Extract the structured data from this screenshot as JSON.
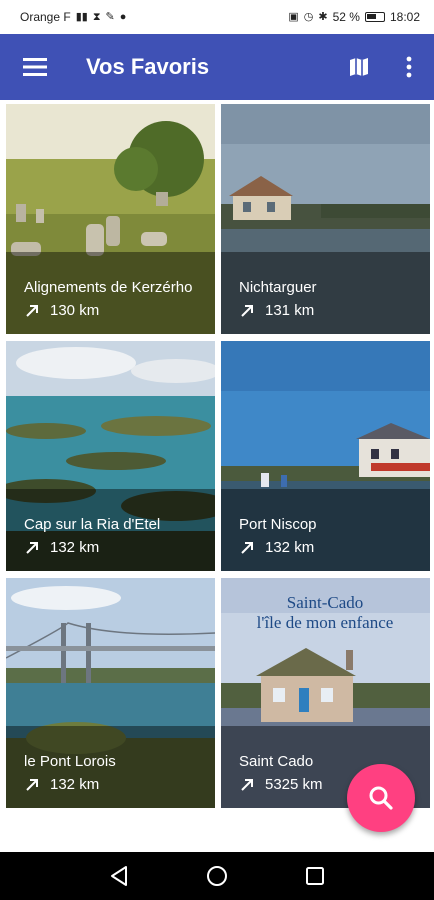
{
  "status_bar": {
    "carrier": "Orange F",
    "battery": "52 %",
    "time": "18:02"
  },
  "app_bar": {
    "title": "Vos Favoris",
    "menu_icon": "hamburger-menu-icon",
    "map_icon": "map-icon",
    "more_icon": "more-vert-icon"
  },
  "favorites": [
    {
      "title": "Alignements de Kerzérho",
      "distance": "130 km"
    },
    {
      "title": "Nichtarguer",
      "distance": "131 km"
    },
    {
      "title": "Cap sur la Ria d'Etel",
      "distance": "132 km"
    },
    {
      "title": "Port Niscop",
      "distance": "132 km"
    },
    {
      "title": "le Pont Lorois",
      "distance": "132 km"
    },
    {
      "title": "Saint Cado",
      "distance": "5325 km",
      "image_text": "Saint-Cado\nl'île de mon enfance"
    }
  ],
  "fab": {
    "icon": "search-icon"
  },
  "nav_bar": {
    "back": "back-triangle-icon",
    "home": "home-circle-icon",
    "recents": "recents-square-icon"
  },
  "colors": {
    "app_bar": "#3f51b5",
    "fab": "#ff4081",
    "nav_bar": "#000000"
  }
}
